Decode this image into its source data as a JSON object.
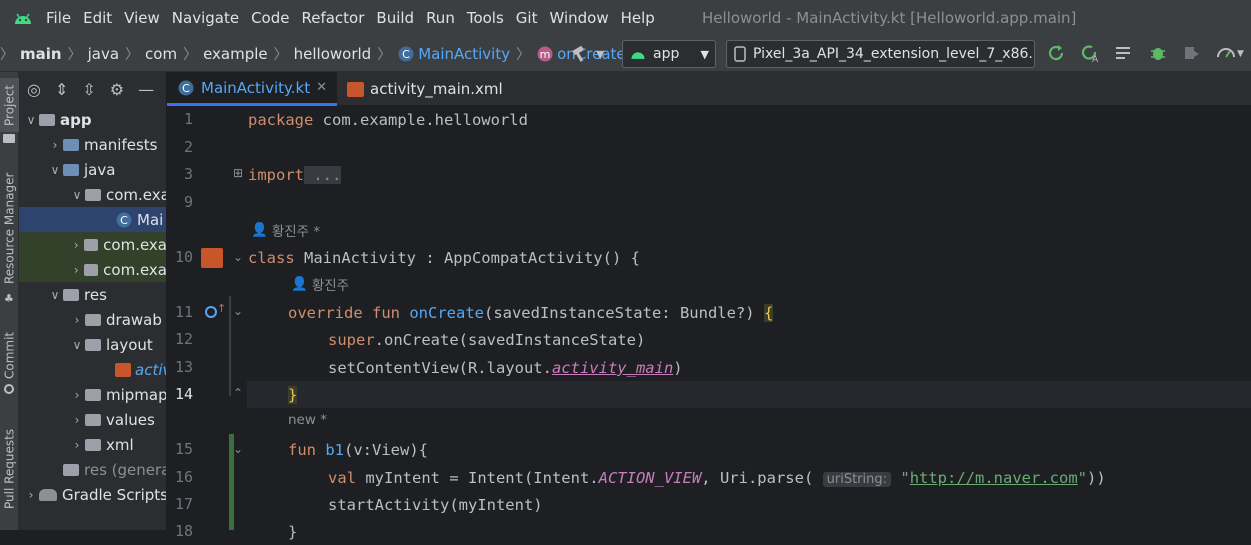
{
  "menubar": {
    "items": [
      "File",
      "Edit",
      "View",
      "Navigate",
      "Code",
      "Refactor",
      "Build",
      "Run",
      "Tools",
      "Git",
      "Window",
      "Help"
    ],
    "window_title": "Helloworld - MainActivity.kt [Helloworld.app.main]"
  },
  "navbar": {
    "crumbs": [
      "main",
      "java",
      "com",
      "example",
      "helloworld",
      "MainActivity",
      "onCreate"
    ],
    "run_config": "app",
    "device": "Pixel_3a_API_34_extension_level_7_x86..."
  },
  "sidestrip": {
    "tabs": [
      "Project",
      "Resource Manager",
      "Commit",
      "Pull Requests"
    ]
  },
  "tree": [
    {
      "label": "app",
      "bold": true
    },
    {
      "label": "manifests"
    },
    {
      "label": "java"
    },
    {
      "label": "com.exa"
    },
    {
      "label": "Mai"
    },
    {
      "label": "com.exa"
    },
    {
      "label": "com.exa"
    },
    {
      "label": "res"
    },
    {
      "label": "drawab"
    },
    {
      "label": "layout"
    },
    {
      "label": "activ"
    },
    {
      "label": "mipmap"
    },
    {
      "label": "values"
    },
    {
      "label": "xml"
    },
    {
      "label": "res (genera"
    },
    {
      "label": "Gradle Scripts"
    }
  ],
  "tabs": [
    {
      "label": "MainActivity.kt",
      "active": true
    },
    {
      "label": "activity_main.xml",
      "active": false
    }
  ],
  "gutter": {
    "numbers": [
      "1",
      "2",
      "3",
      "9",
      "10",
      "11",
      "12",
      "13",
      "14",
      "15",
      "16",
      "17",
      "18"
    ]
  },
  "code": {
    "l1": [
      "package",
      " com.example.helloworld"
    ],
    "l3": [
      "import",
      " ..."
    ],
    "author": "황진주 *",
    "l10": [
      "class",
      " MainActivity : AppCompatActivity() {"
    ],
    "author2": "황진주",
    "l11": [
      "override fun ",
      "onCreate",
      "(savedInstanceState: Bundle?) ",
      "{"
    ],
    "l12": [
      "super",
      ".onCreate(savedInstanceState)"
    ],
    "l13": [
      "setContentView(R.layout.",
      "activity_main",
      ")"
    ],
    "l14": "}",
    "new_hint": "new *",
    "l15": [
      "fun ",
      "b1",
      "(v:View){"
    ],
    "l16": [
      "val",
      " myIntent = Intent(Intent.",
      "ACTION_VIEW",
      ", Uri.parse( ",
      "uriString:",
      " ",
      "\"",
      "http://m.naver.com",
      "\"",
      "))"
    ],
    "l17": "startActivity(myIntent)",
    "l18": "}"
  }
}
